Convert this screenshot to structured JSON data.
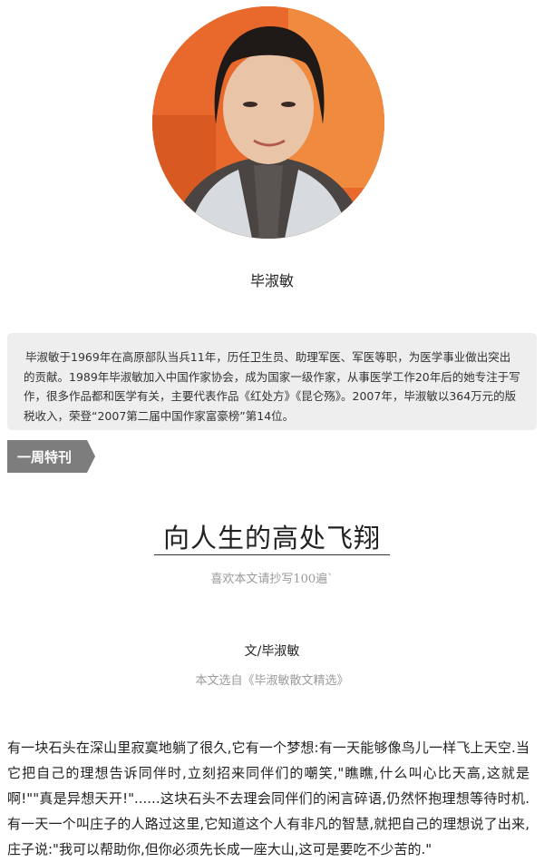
{
  "author": {
    "name": "毕淑敏",
    "bio": "毕淑敏于1969年在高原部队当兵11年，历任卫生员、助理军医、军医等职，为医学事业做出突出的贡献。1989年毕淑敏加入中国作家协会，成为国家一级作家，从事医学工作20年后的她专注于写作，很多作品都和医学有关，主要代表作品《红处方》《昆仑殇》。2007年，毕淑敏以364万元的版税收入，荣登“2007第二届中国作家富豪榜”第14位。"
  },
  "section": {
    "label": "一周特刊"
  },
  "article": {
    "title": "向人生的高处飞翔",
    "subtitle": "喜欢本文请抄写100遍`",
    "byline": "文/毕淑敏",
    "source": "本文选自《毕淑敏散文精选》",
    "body": "有一块石头在深山里寂寞地躺了很久,它有一个梦想:有一天能够像鸟儿一样飞上天空.当它把自己的理想告诉同伴时,立刻招来同伴们的嘲笑,\"瞧瞧,什么叫心比天高,这就是啊!\"\"真是异想天开!\"......这块石头不去理会同伴们的闲言碎语,仍然怀抱理想等待时机.有一天一个叫庄子的人路过这里,它知道这个人有非凡的智慧,就把自己的理想说了出来,庄子说:\"我可以帮助你,但你必须先长成一座大山,这可是要吃不少苦的.\""
  },
  "colors": {
    "tag_bg": "#7d7d7d",
    "bio_bg": "#eeeeee",
    "muted_text": "#9a9a9a"
  }
}
